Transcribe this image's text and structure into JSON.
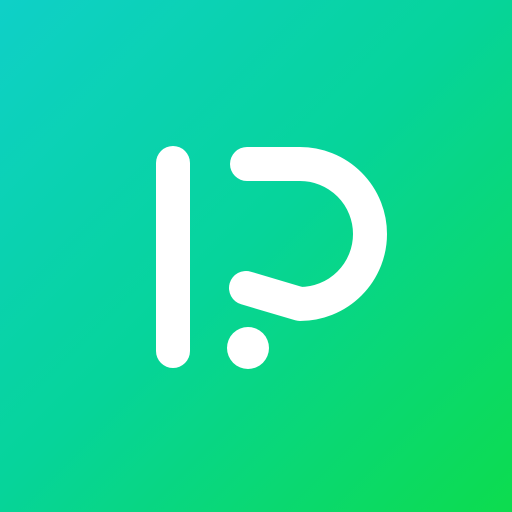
{
  "icon": {
    "name": "app-logo",
    "glyph_color": "#ffffff",
    "gradient": {
      "from": "#0fd0c8",
      "mid": "#06d49a",
      "to": "#0ddc4e"
    }
  }
}
